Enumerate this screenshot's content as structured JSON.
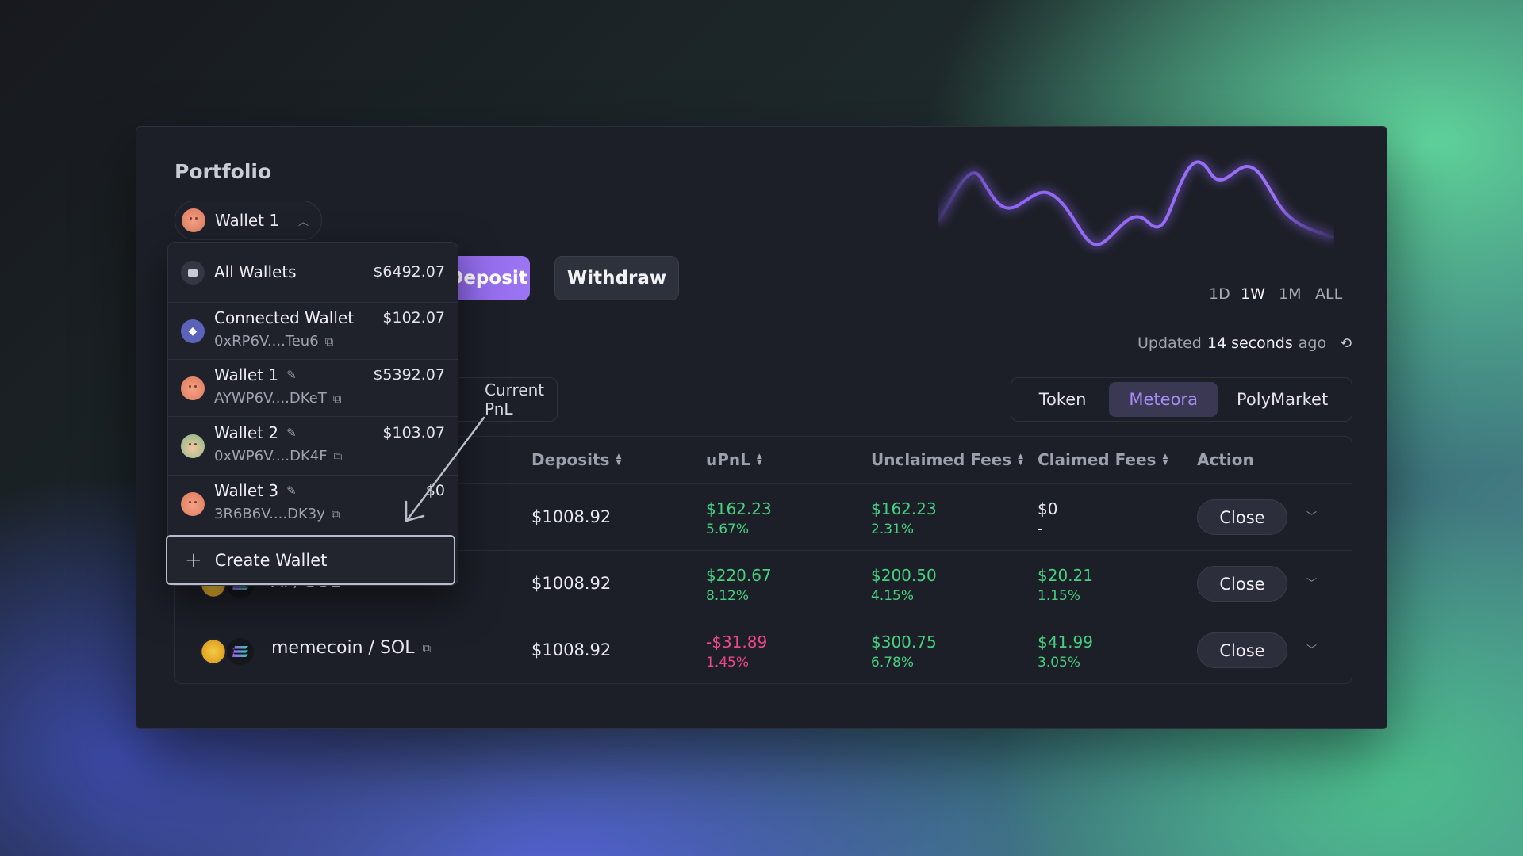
{
  "portfolio": {
    "title": "Portfolio"
  },
  "wallet_selector": {
    "label": "Wallet 1"
  },
  "actions": {
    "deposit": "Deposit",
    "withdraw": "Withdraw"
  },
  "pnl_tab": {
    "label": "Current PnL"
  },
  "time_ranges": [
    "1D",
    "1W",
    "1M",
    "ALL"
  ],
  "active_range": "1W",
  "updated": {
    "prefix": "Updated",
    "value": "14 seconds",
    "suffix": "ago"
  },
  "segments": {
    "items": [
      "Token",
      "Meteora",
      "PolyMarket"
    ],
    "active": "Meteora"
  },
  "table": {
    "headers": {
      "deposits": "Deposits",
      "upnl": "uPnL",
      "unclaimed": "Unclaimed Fees",
      "claimed": "Claimed Fees",
      "action": "Action"
    },
    "rows": [
      {
        "pair": "",
        "deposits": "$1008.92",
        "upnl": "$162.23",
        "upnl_pct": "5.67%",
        "upnl_status": "positive",
        "unclaimed": "$162.23",
        "unclaimed_pct": "2.31%",
        "claimed": "$0",
        "claimed_pct": "-",
        "action": "Close"
      },
      {
        "pair": "AI / SOL",
        "deposits": "$1008.92",
        "upnl": "$220.67",
        "upnl_pct": "8.12%",
        "upnl_status": "positive",
        "unclaimed": "$200.50",
        "unclaimed_pct": "4.15%",
        "claimed": "$20.21",
        "claimed_pct": "1.15%",
        "action": "Close"
      },
      {
        "pair": "memecoin / SOL",
        "deposits": "$1008.92",
        "upnl": "-$31.89",
        "upnl_pct": "1.45%",
        "upnl_status": "negative",
        "unclaimed": "$300.75",
        "unclaimed_pct": "6.78%",
        "claimed": "$41.99",
        "claimed_pct": "3.05%",
        "action": "Close"
      }
    ]
  },
  "dropdown": {
    "items": [
      {
        "name": "All Wallets",
        "amount": "$6492.07",
        "address": "",
        "icon": "wallets-icon"
      },
      {
        "name": "Connected Wallet",
        "amount": "$102.07",
        "address": "0xRP6V....Teu6",
        "icon": "ethereum-icon"
      },
      {
        "name": "Wallet 1",
        "amount": "$5392.07",
        "address": "AYWP6V....DKeT",
        "icon": "avatar"
      },
      {
        "name": "Wallet 2",
        "amount": "$103.07",
        "address": "0xWP6V....DK4F",
        "icon": "avatar"
      },
      {
        "name": "Wallet 3",
        "amount": "$0",
        "address": "3R6B6V....DK3y",
        "icon": "avatar"
      }
    ],
    "create_label": "Create Wallet"
  },
  "colors": {
    "accent": "#9b75f2",
    "positive": "#46d07f",
    "negative": "#f0478a"
  }
}
